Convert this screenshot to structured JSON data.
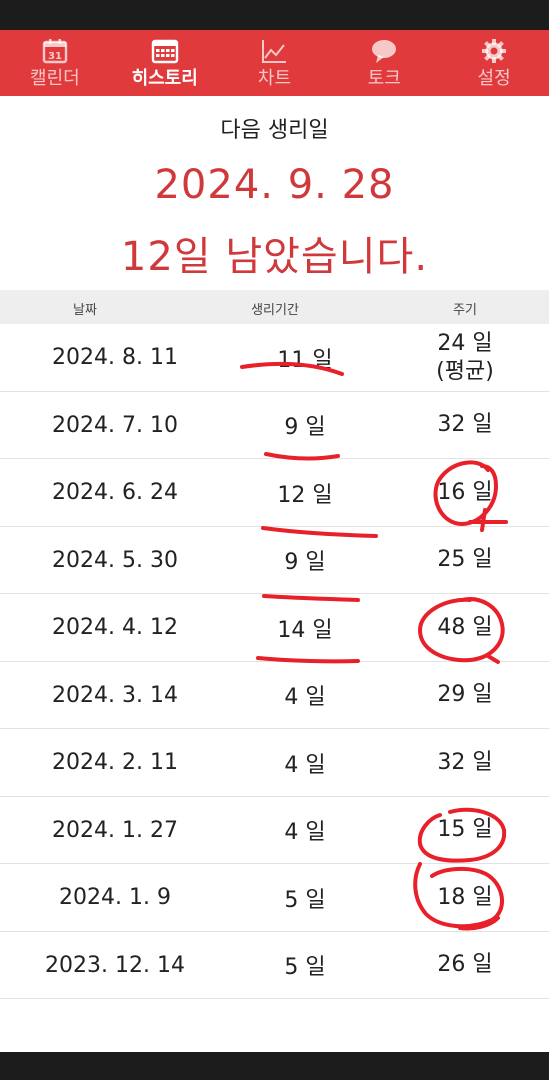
{
  "nav": {
    "tabs": [
      {
        "label": "캘린더",
        "icon": "calendar-icon",
        "icon_text": "31"
      },
      {
        "label": "히스토리",
        "icon": "history-icon",
        "active": true
      },
      {
        "label": "차트",
        "icon": "chart-icon"
      },
      {
        "label": "토크",
        "icon": "chat-icon"
      },
      {
        "label": "설정",
        "icon": "settings-icon"
      }
    ],
    "color": "#e03a3c"
  },
  "summary": {
    "title": "다음 생리일",
    "next_date": "2024. 9. 28",
    "remaining": "12일 남았습니다."
  },
  "table": {
    "headers": {
      "date": "날짜",
      "period": "생리기간",
      "cycle": "주기"
    },
    "rows": [
      {
        "date": "2024. 8. 11",
        "period": "11 일",
        "cycle": "24 일",
        "note": "(평균)"
      },
      {
        "date": "2024. 7. 10",
        "period": "9 일",
        "cycle": "32 일"
      },
      {
        "date": "2024. 6. 24",
        "period": "12 일",
        "cycle": "16 일"
      },
      {
        "date": "2024. 5. 30",
        "period": "9 일",
        "cycle": "25 일"
      },
      {
        "date": "2024. 4. 12",
        "period": "14 일",
        "cycle": "48 일"
      },
      {
        "date": "2024. 3. 14",
        "period": "4 일",
        "cycle": "29 일"
      },
      {
        "date": "2024. 2. 11",
        "period": "4 일",
        "cycle": "32 일"
      },
      {
        "date": "2024. 1. 27",
        "period": "4 일",
        "cycle": "15 일"
      },
      {
        "date": "2024. 1. 9",
        "period": "5 일",
        "cycle": "18 일"
      },
      {
        "date": "2023. 12. 14",
        "period": "5 일",
        "cycle": "26 일"
      }
    ]
  },
  "colors": {
    "accent": "#d0393b",
    "annotation": "#e8202a"
  }
}
